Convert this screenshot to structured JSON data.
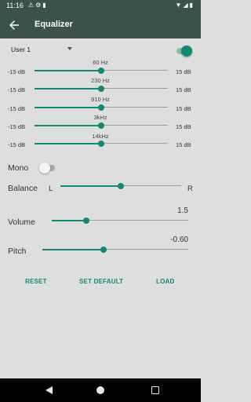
{
  "status_bar": {
    "time": "11:16",
    "left_icons": [
      "alert-icon",
      "settings-icon",
      "sd-card-icon"
    ],
    "right_icons": [
      "wifi-icon",
      "signal-icon",
      "battery-icon"
    ]
  },
  "app_bar": {
    "title": "Equalizer",
    "back_icon": "arrow-back-icon"
  },
  "preset": {
    "selected": "User 1",
    "enabled": true
  },
  "bands": [
    {
      "freq": "60 Hz",
      "min": "-15 dB",
      "max": "15 dB",
      "value_db": 0
    },
    {
      "freq": "230 Hz",
      "min": "-15 dB",
      "max": "15 dB",
      "value_db": 0
    },
    {
      "freq": "910 Hz",
      "min": "-15 dB",
      "max": "15 dB",
      "value_db": 0
    },
    {
      "freq": "3kHz",
      "min": "-15 dB",
      "max": "15 dB",
      "value_db": 0
    },
    {
      "freq": "14kHz",
      "min": "-15 dB",
      "max": "15 dB",
      "value_db": 0
    }
  ],
  "mono": {
    "label": "Mono",
    "enabled": false
  },
  "balance": {
    "label": "Balance",
    "left": "L",
    "right": "R",
    "position": 0.5
  },
  "volume": {
    "label": "Volume",
    "value": "1.5",
    "position": 0.25
  },
  "pitch": {
    "label": "Pitch",
    "value": "-0.60",
    "position": 0.42
  },
  "actions": {
    "reset": "RESET",
    "set_default": "SET DEFAULT",
    "load": "LOAD"
  },
  "colors": {
    "accent": "#0f8a74",
    "bar": "#3b5249",
    "background": "#dedede"
  }
}
